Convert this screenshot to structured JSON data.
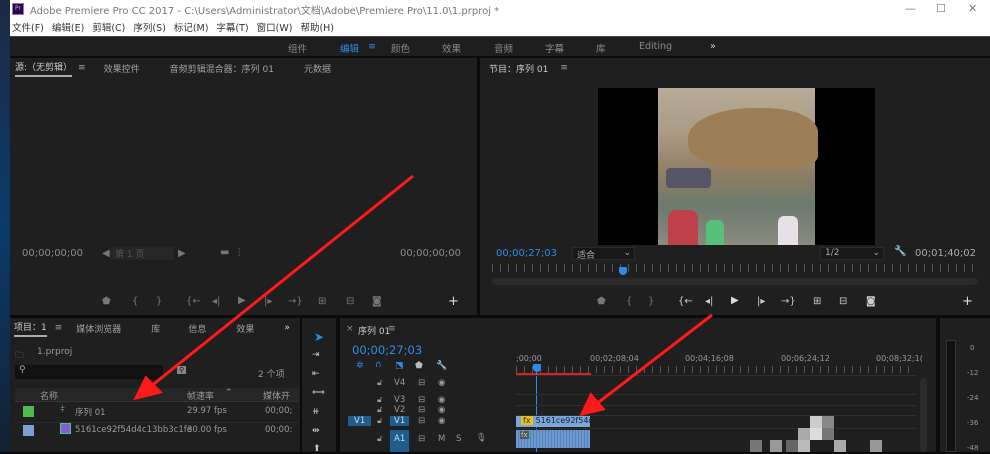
{
  "window": {
    "title": "Adobe Premiere Pro CC 2017 - C:\\Users\\Administrator\\文档\\Adobe\\Premiere Pro\\11.0\\1.prproj *",
    "app_icon": "Pr",
    "minimize": "—",
    "maximize": "☐",
    "close": "✕"
  },
  "menu": [
    "文件(F)",
    "编辑(E)",
    "剪辑(C)",
    "序列(S)",
    "标记(M)",
    "字幕(T)",
    "窗口(W)",
    "帮助(H)"
  ],
  "workspaces": {
    "items": [
      "组件",
      "编辑",
      "颜色",
      "效果",
      "音频",
      "字幕",
      "库",
      "Editing"
    ],
    "active": "编辑",
    "menu_icon": "≡",
    "overflow": "»"
  },
  "source": {
    "tabs": [
      "源:（无剪辑）",
      "效果控件",
      "音频剪辑混合器：序列 01",
      "元数据"
    ],
    "menu_icon": "≡",
    "timecode_in": "00;00;00;00",
    "timecode_out": "00;00;00;00",
    "page": "第 1 页"
  },
  "program": {
    "title": "节目：序列 01",
    "menu_icon": "≡",
    "timecode": "00;00;27;03",
    "fit": "适合",
    "resolution": "1/2",
    "duration": "00;01;40;02",
    "playhead_fraction": 0.27
  },
  "project": {
    "tabs": [
      "项目：1",
      "媒体浏览器",
      "库",
      "信息",
      "效果"
    ],
    "menu_icon": "≡",
    "overflow": "»",
    "file": "1.prproj",
    "item_count": "2 个项",
    "search_placeholder": "",
    "columns": [
      "名称",
      "帧速率",
      "媒体开"
    ],
    "rows": [
      {
        "name": "序列 01",
        "fps": "29.97 fps",
        "start": "00;00;",
        "color": "#4cbb4c"
      },
      {
        "name": "5161ce92f54d4c13bb3c1fe",
        "fps": "30.00 fps",
        "start": "00;00:",
        "color": "#7a9fd4"
      }
    ]
  },
  "timeline": {
    "title": "序列 01",
    "close": "×",
    "menu_icon": "≡",
    "timecode": "00;00;27;03",
    "ruler": [
      ";00;00",
      "00;02;08;04",
      "00;04;16;08",
      "00;06;24;12",
      "00;08;32;1("
    ],
    "tracks": [
      "V4",
      "V3",
      "V2",
      "V1",
      "A1"
    ],
    "source_patch_v": "V1",
    "mute": "M",
    "solo": "S",
    "clip_name": "5161ce92f54d",
    "fx": "fx"
  },
  "meter": {
    "scale": [
      "0",
      "-12",
      "-24",
      "-36",
      "-48"
    ]
  },
  "colors": {
    "accent": "#2d8ceb",
    "annotation": "#ff1a1a"
  }
}
